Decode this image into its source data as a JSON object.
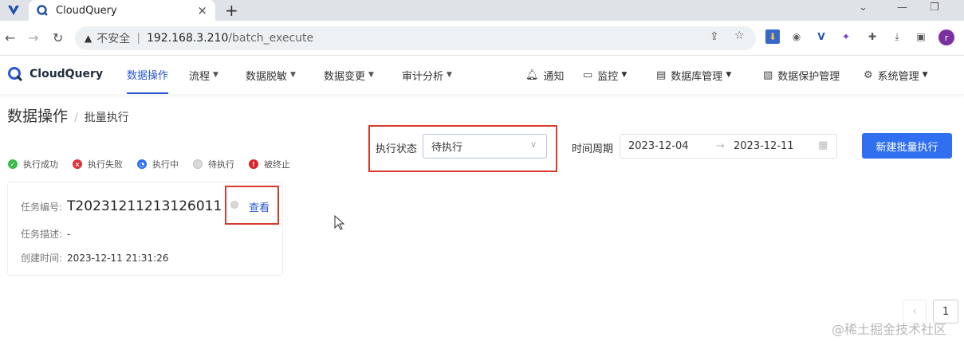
{
  "browser": {
    "tab_title": "CloudQuery",
    "tab_close": "×",
    "new_tab": "+",
    "insecure_label": "不安全",
    "separator": "|",
    "url_host": "192.168.3.210",
    "url_path": "/batch_execute",
    "avatar_letter": "r"
  },
  "header": {
    "brand": "CloudQuery",
    "nav": [
      {
        "label": "数据操作"
      },
      {
        "label": "流程"
      },
      {
        "label": "数据脱敏"
      },
      {
        "label": "数据变更"
      },
      {
        "label": "审计分析"
      }
    ],
    "right_nav": [
      {
        "label": "通知"
      },
      {
        "label": "监控"
      },
      {
        "label": "数据库管理"
      },
      {
        "label": "数据保护管理"
      },
      {
        "label": "系统管理"
      }
    ]
  },
  "breadcrumb": {
    "parent": "数据操作",
    "divider": "/",
    "current": "批量执行"
  },
  "legend": [
    {
      "label": "执行成功",
      "color": "#3cb94a"
    },
    {
      "label": "执行失败",
      "color": "#d9363e"
    },
    {
      "label": "执行中",
      "color": "#2f6ff0"
    },
    {
      "label": "待执行",
      "color": "#cfcfcf"
    },
    {
      "label": "被终止",
      "color": "#d9262e"
    }
  ],
  "filters": {
    "status_label": "执行状态",
    "status_value": "待执行",
    "period_label": "时间周期",
    "start_date": "2023-12-04",
    "range_arrow": "→",
    "end_date": "2023-12-11"
  },
  "actions": {
    "new_batch": "新建批量执行"
  },
  "task": {
    "id_label": "任务编号:",
    "id_value": "T20231211213126011",
    "desc_label": "任务描述:",
    "desc_value": "-",
    "created_label": "创建时间:",
    "created_value": "2023-12-11 21:31:26",
    "view_link": "查看"
  },
  "pagination": {
    "prev": "‹",
    "current_page": "1"
  },
  "watermark": "@稀土掘金技术社区"
}
